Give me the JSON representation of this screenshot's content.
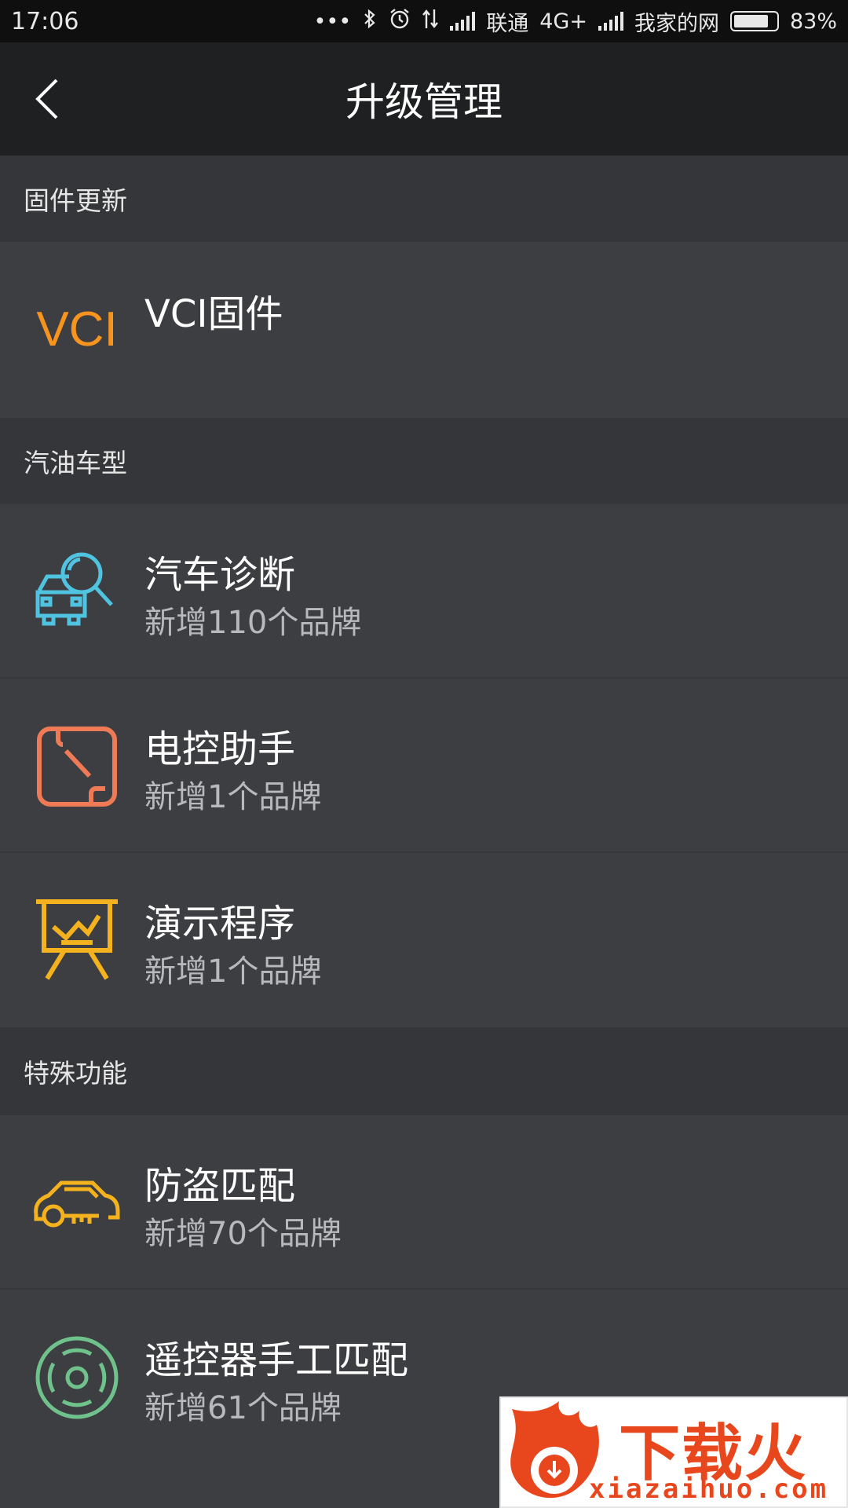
{
  "status_bar": {
    "time": "17:06",
    "more": "•••",
    "carrier1": "联通",
    "network": "4G+",
    "carrier2": "我家的网",
    "battery": "83%",
    "battery_level": 0.83
  },
  "toolbar": {
    "title": "升级管理"
  },
  "sections": [
    {
      "header": "固件更新",
      "items": [
        {
          "title": "VCI固件",
          "subtitle": "",
          "icon": "vci-logo-icon",
          "icon_label": "VCI",
          "color": "#f7941d"
        }
      ]
    },
    {
      "header": "汽油车型",
      "items": [
        {
          "title": "汽车诊断",
          "subtitle": "新增110个品牌",
          "icon": "car-diagnosis-icon",
          "color": "#4fc3e0"
        },
        {
          "title": "电控助手",
          "subtitle": "新增1个品牌",
          "icon": "ecu-assistant-icon",
          "color": "#f07a55"
        },
        {
          "title": "演示程序",
          "subtitle": "新增1个品牌",
          "icon": "presentation-board-icon",
          "color": "#f5b21f"
        }
      ]
    },
    {
      "header": "特殊功能",
      "items": [
        {
          "title": "防盗匹配",
          "subtitle": "新增70个品牌",
          "icon": "car-key-icon",
          "color": "#f5b21f"
        },
        {
          "title": "遥控器手工匹配",
          "subtitle": "新增61个品牌",
          "icon": "remote-control-icon",
          "color": "#6fc28b"
        }
      ]
    }
  ],
  "watermark": {
    "text": "下载火",
    "url": "xiazaihuo.com"
  }
}
